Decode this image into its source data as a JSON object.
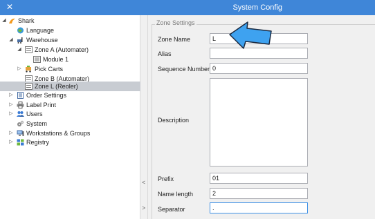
{
  "window": {
    "title": "System Config",
    "close_glyph": "✕"
  },
  "tree": {
    "nodes": [
      {
        "label": "Shark",
        "icon": "shark-logo-icon",
        "expand": "◢"
      },
      {
        "label": "Language",
        "icon": "globe-icon",
        "expand": ""
      },
      {
        "label": "Warehouse",
        "icon": "forklift-icon",
        "expand": "◢"
      },
      {
        "label": "Zone A (Automater)",
        "icon": "zone-icon",
        "expand": "◢"
      },
      {
        "label": "Module 1",
        "icon": "module-icon",
        "expand": ""
      },
      {
        "label": "Pick Carts",
        "icon": "cart-icon",
        "expand": "▷"
      },
      {
        "label": "Zone B (Automater)",
        "icon": "zone-icon",
        "expand": ""
      },
      {
        "label": "Zone L (Reoler)",
        "icon": "zone-icon",
        "expand": ""
      },
      {
        "label": "Order Settings",
        "icon": "document-icon",
        "expand": "▷"
      },
      {
        "label": "Label Print",
        "icon": "printer-icon",
        "expand": "▷"
      },
      {
        "label": "Users",
        "icon": "users-icon",
        "expand": "▷"
      },
      {
        "label": "System",
        "icon": "gears-icon",
        "expand": ""
      },
      {
        "label": "Workstations & Groups",
        "icon": "workstation-icon",
        "expand": "▷"
      },
      {
        "label": "Registry",
        "icon": "registry-icon",
        "expand": "▷"
      }
    ],
    "selected": "Zone L (Reoler)"
  },
  "splitter": {
    "collapse_glyph": "<",
    "expand_glyph": ">"
  },
  "zone_settings": {
    "legend": "Zone Settings",
    "zone_name": {
      "label": "Zone Name",
      "value": "L"
    },
    "alias": {
      "label": "Alias",
      "value": ""
    },
    "sequence_number": {
      "label": "Sequence Number",
      "value": "0"
    },
    "description": {
      "label": "Description",
      "value": ""
    },
    "prefix": {
      "label": "Prefix",
      "value": "01"
    },
    "name_length": {
      "label": "Name length",
      "value": "2"
    },
    "separator": {
      "label": "Separator",
      "value": "."
    }
  },
  "colors": {
    "titlebar": "#3f86d8",
    "selection": "#c8ccd2",
    "arrow": "#3ea2f0"
  }
}
